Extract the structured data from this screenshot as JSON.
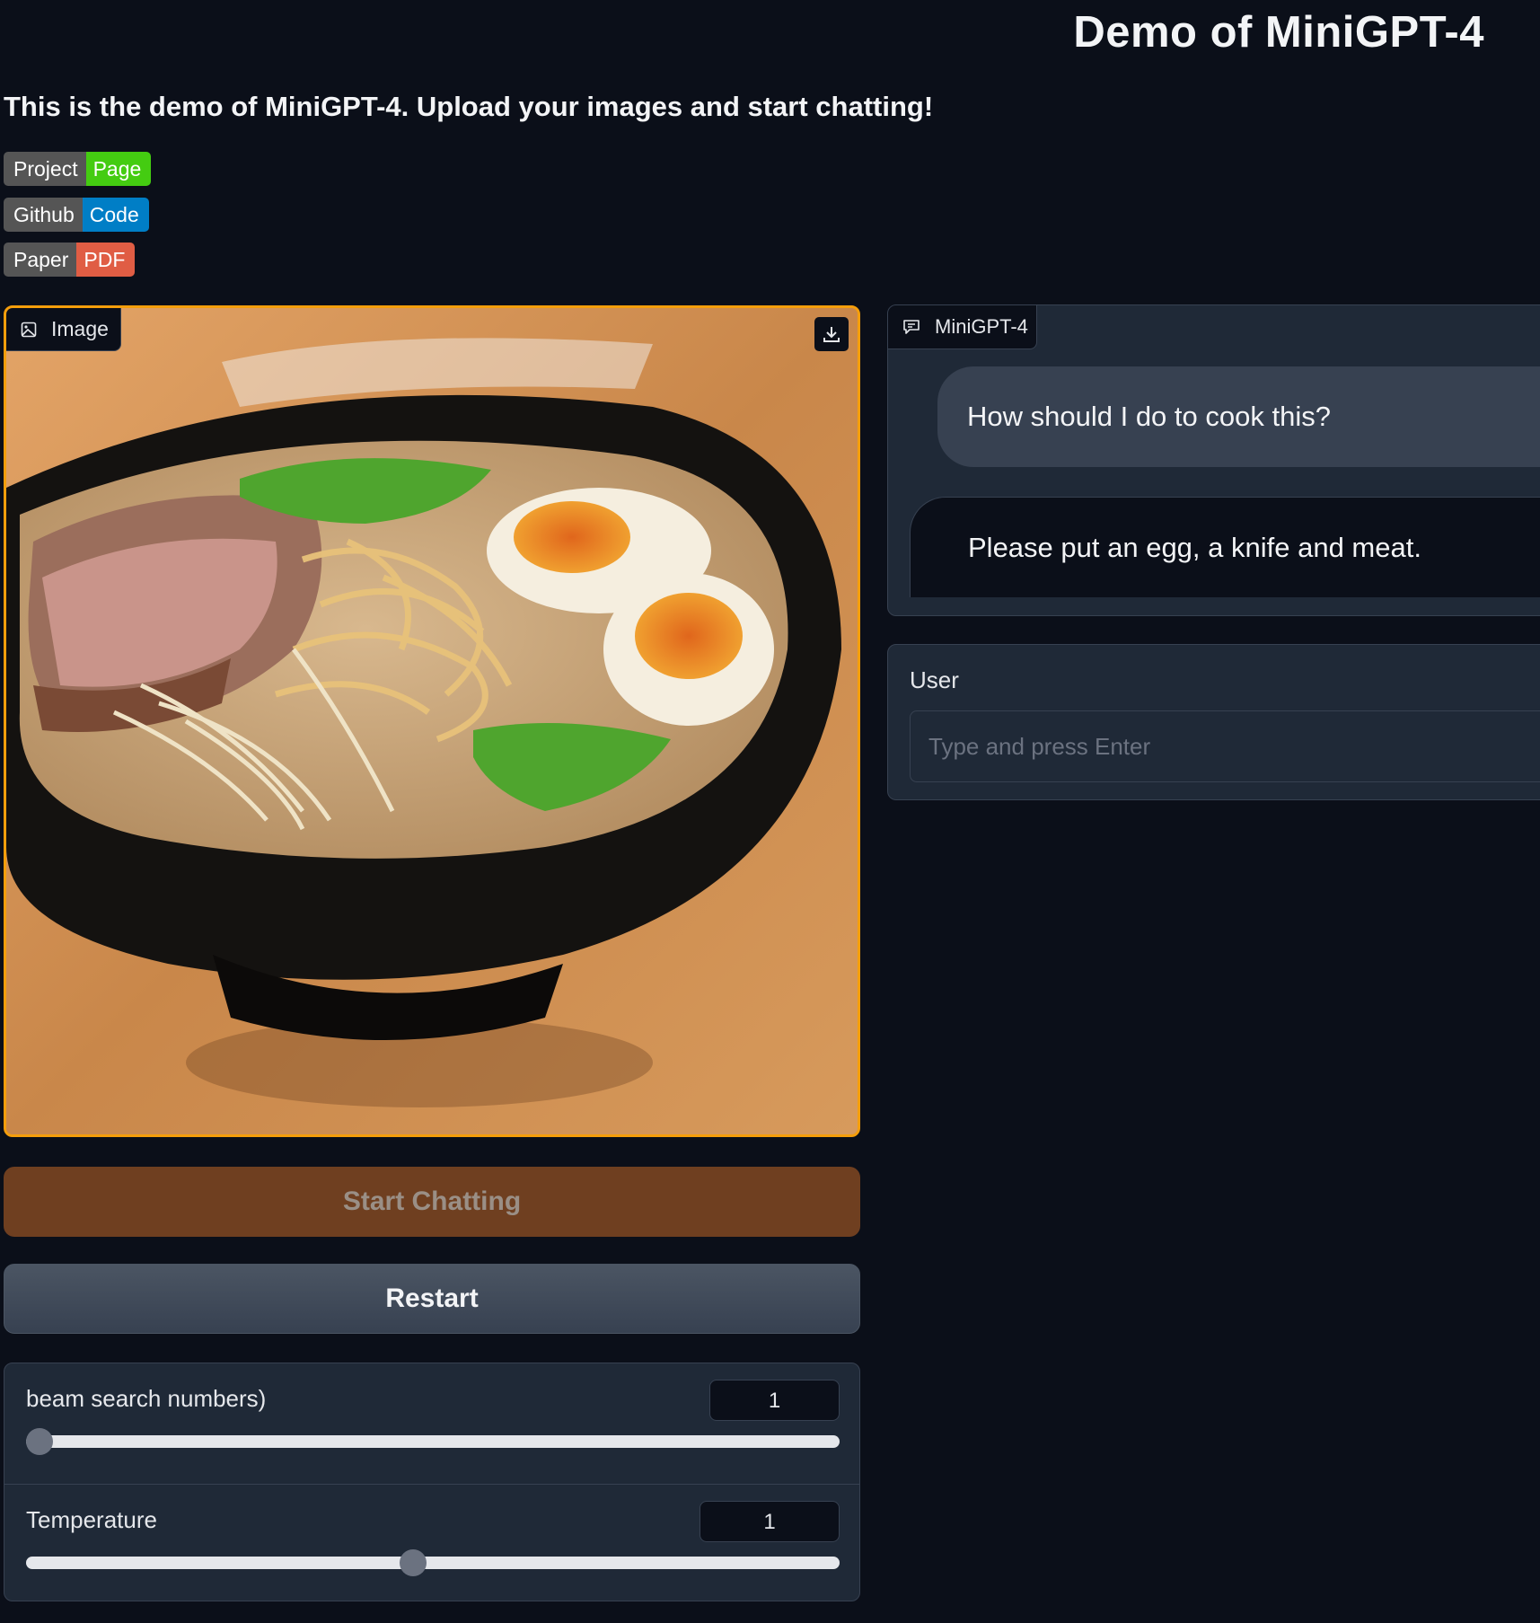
{
  "header": {
    "title": "Demo of MiniGPT-4",
    "subtitle": "This is the demo of MiniGPT-4. Upload your images and start chatting!"
  },
  "badges": [
    {
      "left": "Project",
      "right": "Page",
      "color": "#44cc11"
    },
    {
      "left": "Github",
      "right": "Code",
      "color": "#007ec6"
    },
    {
      "left": "Paper",
      "right": "PDF",
      "color": "#e05d44"
    }
  ],
  "image_panel": {
    "label": "Image",
    "icon": "image-icon",
    "download_icon": "download-icon",
    "border_color": "#f59e0b"
  },
  "buttons": {
    "start": "Start Chatting",
    "restart": "Restart"
  },
  "sliders": [
    {
      "label": "beam search numbers)",
      "value": "1",
      "level": 0.0
    },
    {
      "label": "Temperature",
      "value": "1",
      "level": 0.476
    }
  ],
  "chat": {
    "label": "MiniGPT-4",
    "icon": "chat-icon",
    "messages": [
      {
        "role": "user",
        "text": "How should I do to cook this?"
      },
      {
        "role": "bot",
        "text": "Please put an egg, a knife and meat."
      }
    ]
  },
  "user_input": {
    "label": "User",
    "placeholder": "Type and press Enter",
    "value": ""
  },
  "colors": {
    "background": "#0b0f19",
    "panel": "#1f2937",
    "accent": "#f59e0b",
    "start_button": "#6f3f20"
  }
}
